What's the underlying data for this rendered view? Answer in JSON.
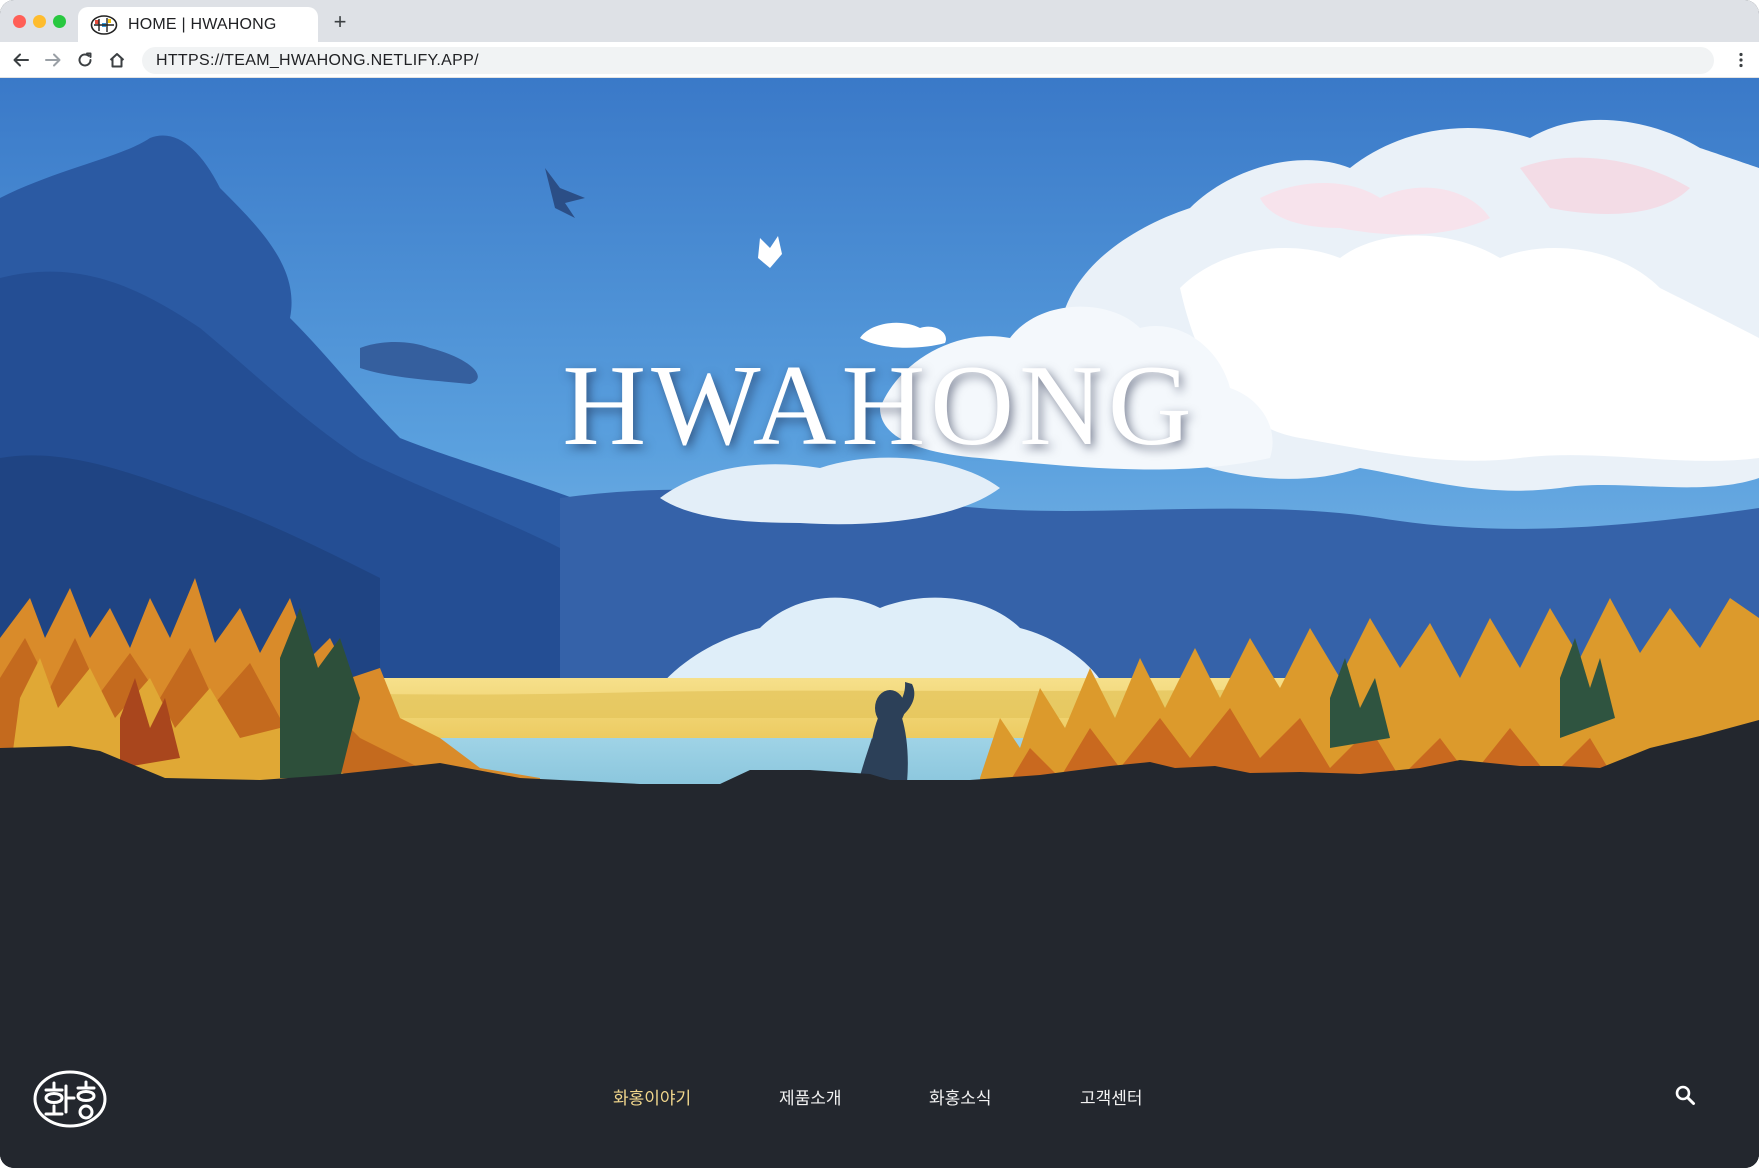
{
  "browser": {
    "tab_title": "HOME | HWAHONG",
    "new_tab_label": "+",
    "url": "HTTPS://TEAM_HWAHONG.NETLIFY.APP/"
  },
  "hero": {
    "title": "HWAHONG"
  },
  "nav": {
    "items": [
      {
        "label": "화홍이야기",
        "active": true
      },
      {
        "label": "제품소개",
        "active": false
      },
      {
        "label": "화홍소식",
        "active": false
      },
      {
        "label": "고객센터",
        "active": false
      }
    ]
  },
  "colors": {
    "page_bg": "#23272e",
    "nav_active": "#f0d68c",
    "nav_text": "#f2f2f2",
    "sky_top": "#2f6fc1",
    "sky_mid": "#5ea3e0"
  },
  "icons": {
    "back": "arrow-left-icon",
    "forward": "arrow-right-icon",
    "reload": "reload-icon",
    "home": "home-icon",
    "menu": "kebab-menu-icon",
    "search": "search-icon",
    "logo": "hwahong-logo-icon"
  }
}
